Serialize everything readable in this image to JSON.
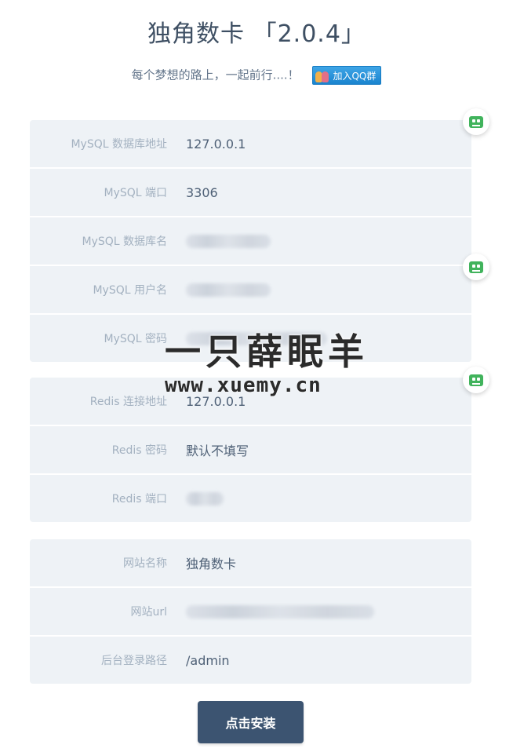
{
  "header": {
    "title": "独角数卡 「2.0.4」",
    "subtitle": "每个梦想的路上，一起前行....！",
    "qq_badge": "加入QQ群"
  },
  "mysql": [
    {
      "label": "MySQL 数据库地址",
      "value": "127.0.0.1",
      "blurred": false
    },
    {
      "label": "MySQL 端口",
      "value": "3306",
      "blurred": false
    },
    {
      "label": "MySQL 数据库名",
      "value": "",
      "blurred": true
    },
    {
      "label": "MySQL 用户名",
      "value": "",
      "blurred": true
    },
    {
      "label": "MySQL 密码",
      "value": "",
      "blurred": true
    }
  ],
  "redis": [
    {
      "label": "Redis 连接地址",
      "value": "127.0.0.1",
      "blurred": false
    },
    {
      "label": "Redis 密码",
      "value": "默认不填写",
      "blurred": false
    },
    {
      "label": "Redis 端口",
      "value": "",
      "blurred": true
    }
  ],
  "site": [
    {
      "label": "网站名称",
      "value": "独角数卡",
      "blurred": false
    },
    {
      "label": "网站url",
      "value": "",
      "blurred": true
    },
    {
      "label": "后台登录路径",
      "value": "/admin",
      "blurred": false
    }
  ],
  "watermark": {
    "main": "一只薛眠羊",
    "url": "www.xuemy.cn"
  },
  "install_button": "点击安装",
  "icons": {
    "side": "robot-face-icon",
    "qq": "qq-group-icon"
  }
}
